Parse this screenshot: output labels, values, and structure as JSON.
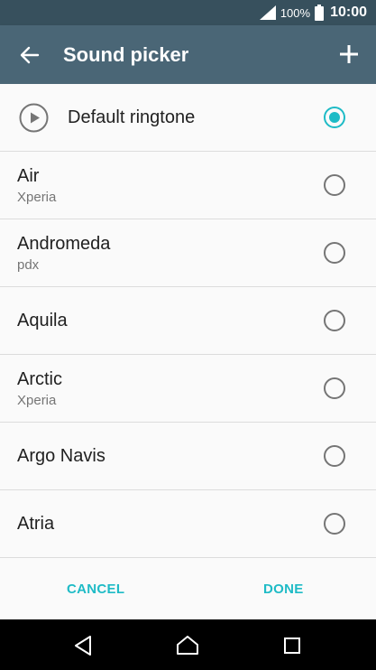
{
  "status_bar": {
    "battery_percent": "100%",
    "time": "10:00",
    "icons": [
      "signal-icon",
      "battery-icon"
    ]
  },
  "app_bar": {
    "title": "Sound picker",
    "back_icon": "arrow-left-icon",
    "add_icon": "plus-icon"
  },
  "colors": {
    "status_bar": "#37505d",
    "app_bar": "#4a6676",
    "accent": "#1ebbc6"
  },
  "sounds": [
    {
      "title": "Default ringtone",
      "subtitle": "",
      "selected": true
    },
    {
      "title": "Air",
      "subtitle": "Xperia",
      "selected": false
    },
    {
      "title": "Andromeda",
      "subtitle": "pdx",
      "selected": false
    },
    {
      "title": "Aquila",
      "subtitle": "",
      "selected": false
    },
    {
      "title": "Arctic",
      "subtitle": "Xperia",
      "selected": false
    },
    {
      "title": "Argo Navis",
      "subtitle": "",
      "selected": false
    },
    {
      "title": "Atria",
      "subtitle": "",
      "selected": false
    }
  ],
  "actions": {
    "cancel_label": "CANCEL",
    "done_label": "DONE"
  },
  "nav_bar": {
    "icons": [
      "back-triangle-icon",
      "home-icon",
      "recents-icon"
    ]
  }
}
